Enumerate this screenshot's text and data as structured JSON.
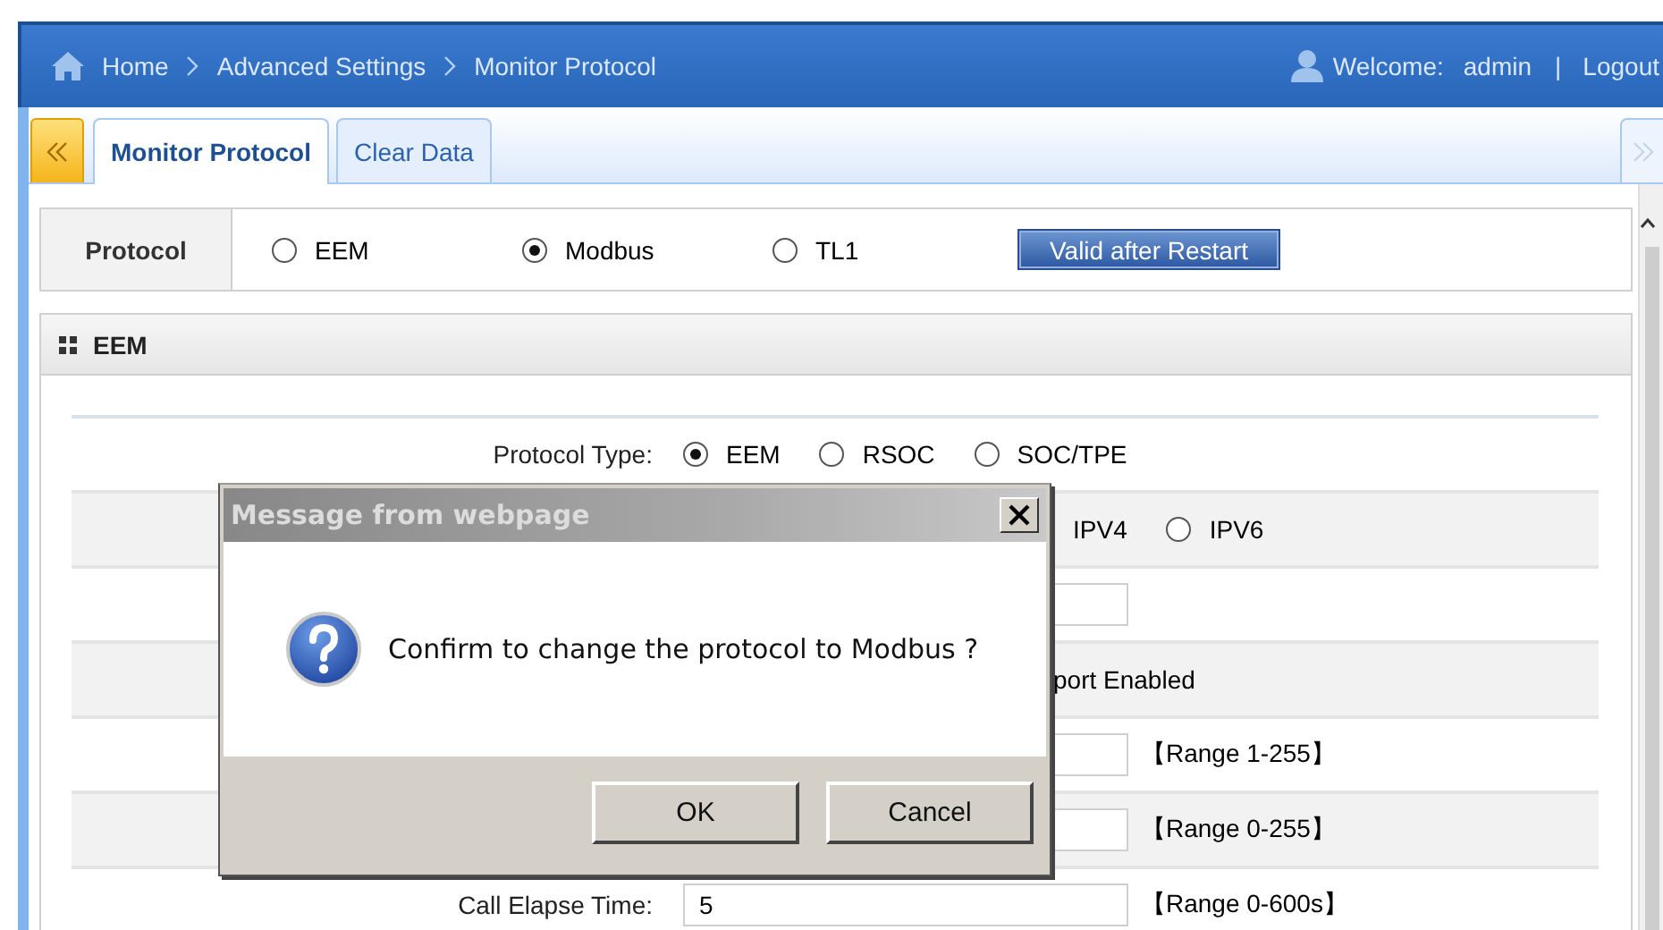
{
  "header": {
    "breadcrumb": [
      "Home",
      "Advanced Settings",
      "Monitor Protocol"
    ],
    "welcome": "Welcome:",
    "user": "admin",
    "separator": "|",
    "logout": "Logout"
  },
  "tabs": [
    {
      "label": "Monitor Protocol",
      "selected": true
    },
    {
      "label": "Clear Data",
      "selected": false
    }
  ],
  "protocol": {
    "label": "Protocol",
    "options": [
      {
        "label": "EEM",
        "selected": false
      },
      {
        "label": "Modbus",
        "selected": true
      },
      {
        "label": "TL1",
        "selected": false
      }
    ],
    "button": "Valid after Restart"
  },
  "section": {
    "title": "EEM",
    "rows": [
      {
        "kind": "radios",
        "label": "Protocol Type:",
        "options": [
          {
            "label": "EEM",
            "selected": true
          },
          {
            "label": "RSOC",
            "selected": false
          },
          {
            "label": "SOC/TPE",
            "selected": false
          }
        ]
      },
      {
        "kind": "covered-radios",
        "options": [
          {
            "label": "IPV4"
          },
          {
            "label": "IPV6",
            "selected": false
          }
        ]
      },
      {
        "kind": "input"
      },
      {
        "kind": "covered-text",
        "text": "port Enabled"
      },
      {
        "kind": "input",
        "range": "【Range 1-255】"
      },
      {
        "kind": "input",
        "range": "【Range 0-255】"
      },
      {
        "kind": "input",
        "label": "Call Elapse Time:",
        "value": "5",
        "range": "【Range 0-600s】"
      }
    ]
  },
  "dialog": {
    "title": "Message from webpage",
    "message": "Confirm to change the protocol to Modbus ?",
    "buttons": [
      "OK",
      "Cancel"
    ]
  }
}
